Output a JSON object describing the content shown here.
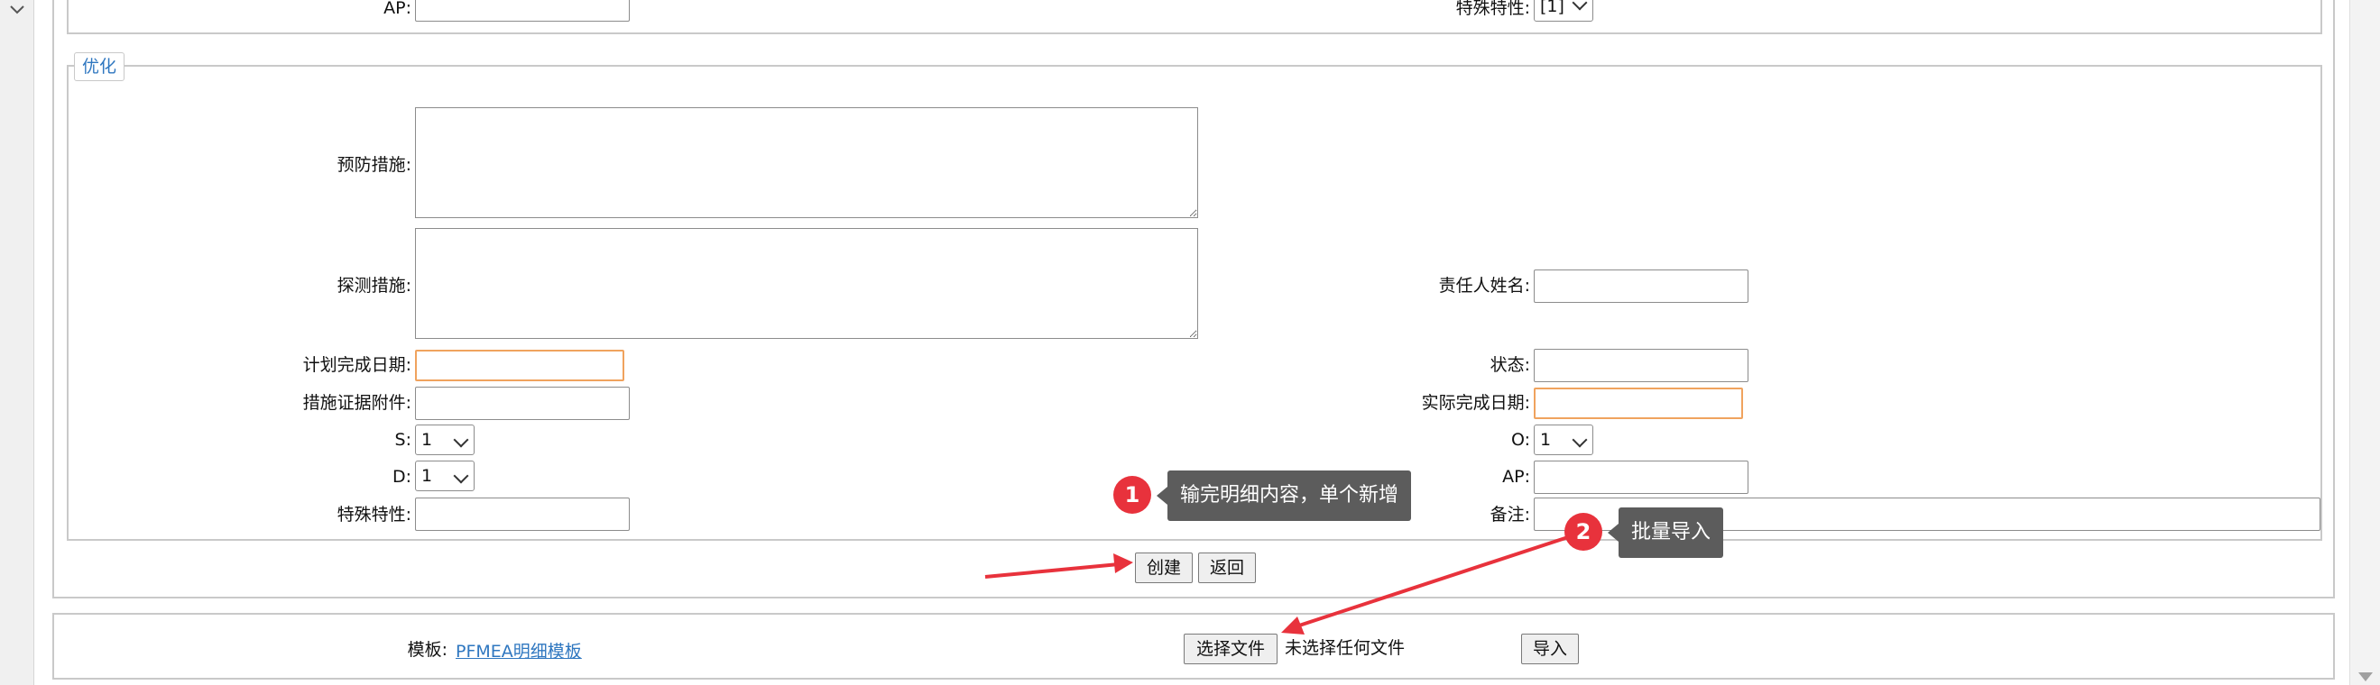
{
  "top_row": {
    "ap_label": "AP:",
    "special_label": "特殊特性:",
    "special_value": "[1]"
  },
  "optimize": {
    "legend": "优化",
    "prevention_label": "预防措施:",
    "detection_label": "探测措施:",
    "owner_label": "责任人姓名:",
    "plan_date_label": "计划完成日期:",
    "status_label": "状态:",
    "evidence_label": "措施证据附件:",
    "actual_date_label": "实际完成日期:",
    "s_label": "S:",
    "s_value": "1",
    "o_label": "O:",
    "o_value": "1",
    "d_label": "D:",
    "d_value": "1",
    "ap_label": "AP:",
    "special_label": "特殊特性:",
    "remark_label": "备注:"
  },
  "actions": {
    "create": "创建",
    "back": "返回"
  },
  "import": {
    "template_label": "模板:",
    "template_link": "PFMEA明细模板",
    "choose_file": "选择文件",
    "no_file": "未选择任何文件",
    "import_btn": "导入"
  },
  "annotations": {
    "step1_num": "1",
    "step1_text": "输完明细内容，单个新增",
    "step2_num": "2",
    "step2_text": "批量导入",
    "color": "#e8323c"
  }
}
